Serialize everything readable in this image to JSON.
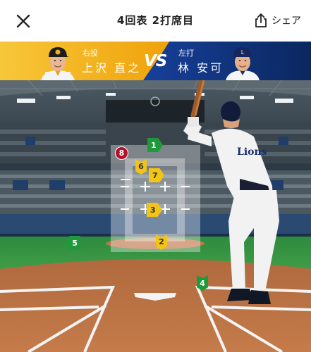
{
  "header": {
    "title": "4回表 2打席目",
    "share_label": "シェア"
  },
  "matchup": {
    "pitcher": {
      "role": "右投",
      "name": "上沢 直之"
    },
    "vs_label": "VS",
    "batter": {
      "role": "左打",
      "name": "林 安可"
    }
  },
  "pitches": [
    {
      "number": "1",
      "result": "green"
    },
    {
      "number": "2",
      "result": "yellow"
    },
    {
      "number": "3",
      "result": "yellow"
    },
    {
      "number": "4",
      "result": "green"
    },
    {
      "number": "5",
      "result": "green"
    },
    {
      "number": "6",
      "result": "yellow"
    },
    {
      "number": "7",
      "result": "yellow"
    },
    {
      "number": "8",
      "result": "red"
    }
  ],
  "colors": {
    "pitcher_team": "#f0a800",
    "batter_team": "#0a2a66",
    "marker_yellow": "#f3c316",
    "marker_green": "#1e9a3a",
    "marker_red": "#b3102a"
  },
  "icons": {
    "close": "close-icon",
    "share": "share-icon"
  }
}
